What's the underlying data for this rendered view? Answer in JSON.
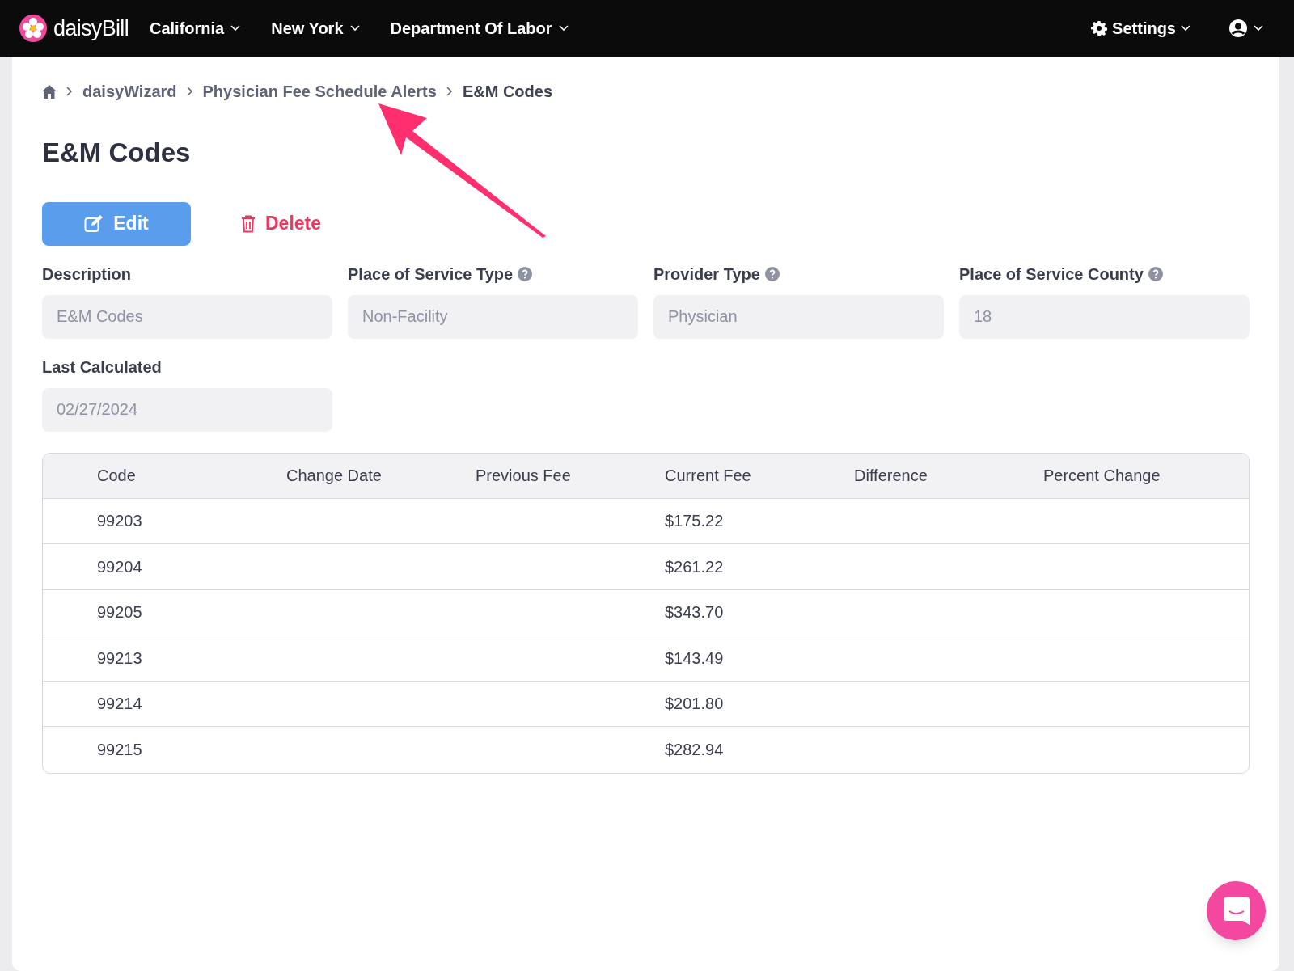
{
  "nav": {
    "logo": "daisyBill",
    "menus": [
      {
        "label": "California"
      },
      {
        "label": "New York"
      },
      {
        "label": "Department Of Labor"
      }
    ],
    "settings": "Settings"
  },
  "breadcrumb": [
    "daisyWizard",
    "Physician Fee Schedule Alerts",
    "E&M Codes"
  ],
  "title": "E&M Codes",
  "actions": {
    "edit": "Edit",
    "delete": "Delete"
  },
  "fields": [
    {
      "label": "Description",
      "value": "E&M Codes",
      "help": false
    },
    {
      "label": "Place of Service Type",
      "value": "Non-Facility",
      "help": true
    },
    {
      "label": "Provider Type",
      "value": "Physician",
      "help": true
    },
    {
      "label": "Place of Service County",
      "value": "18",
      "help": true
    },
    {
      "label": "Last Calculated",
      "value": "02/27/2024",
      "help": false
    }
  ],
  "table": {
    "columns": [
      "Code",
      "Change Date",
      "Previous Fee",
      "Current Fee",
      "Difference",
      "Percent Change"
    ],
    "rows": [
      [
        "99203",
        "",
        "",
        "$175.22",
        "",
        ""
      ],
      [
        "99204",
        "",
        "",
        "$261.22",
        "",
        ""
      ],
      [
        "99205",
        "",
        "",
        "$343.70",
        "",
        ""
      ],
      [
        "99213",
        "",
        "",
        "$143.49",
        "",
        ""
      ],
      [
        "99214",
        "",
        "",
        "$201.80",
        "",
        ""
      ],
      [
        "99215",
        "",
        "",
        "$282.94",
        "",
        ""
      ]
    ]
  }
}
